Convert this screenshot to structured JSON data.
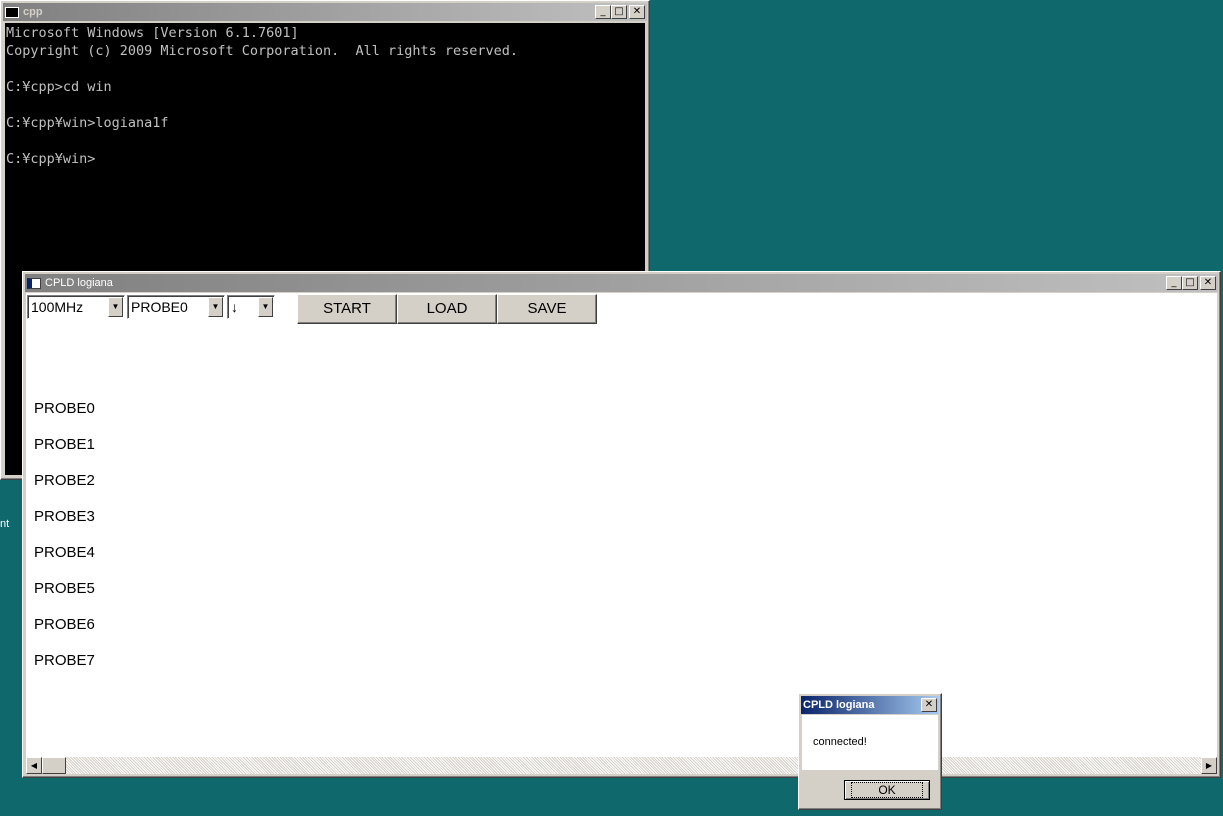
{
  "desktop": {
    "partial_label": "nt"
  },
  "console": {
    "title": "cpp",
    "lines": [
      "Microsoft Windows [Version 6.1.7601]",
      "Copyright (c) 2009 Microsoft Corporation.  All rights reserved.",
      "",
      "C:¥cpp>cd win",
      "",
      "C:¥cpp¥win>logiana1f",
      "",
      "C:¥cpp¥win>"
    ]
  },
  "logiana": {
    "title": "CPLD logiana",
    "freq_value": "100MHz",
    "probe_value": "PROBE0",
    "edge_value": "↓",
    "start_label": "START",
    "load_label": "LOAD",
    "save_label": "SAVE",
    "probes": [
      "PROBE0",
      "PROBE1",
      "PROBE2",
      "PROBE3",
      "PROBE4",
      "PROBE5",
      "PROBE6",
      "PROBE7"
    ]
  },
  "dialog": {
    "title": "CPLD logiana",
    "message": "connected!",
    "ok_label": "OK"
  },
  "icons": {
    "minimize": "_",
    "maximize": "□",
    "close": "✕",
    "dropdown": "▼",
    "scroll_left": "◀",
    "scroll_right": "▶"
  }
}
